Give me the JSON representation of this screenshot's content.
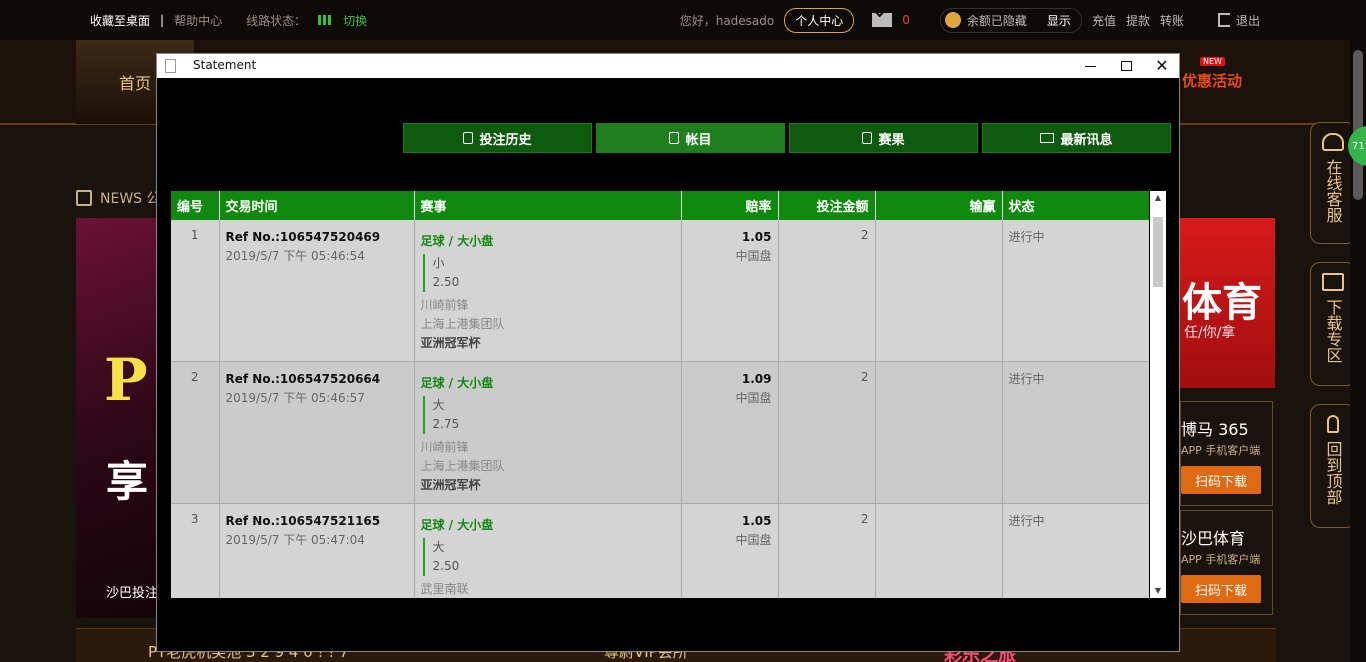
{
  "topbar": {
    "favorite": "收藏至桌面",
    "separator": "|",
    "help": "帮助中心",
    "line_status": "线路状态：",
    "switch": "切换",
    "greeting": "您好，hadesado",
    "personal_center": "个人中心",
    "mail_count": "0",
    "balance_hidden": "余额已隐藏",
    "show": "显示",
    "deposit": "充值",
    "withdraw": "提款",
    "transfer": "转账",
    "logout": "退出"
  },
  "nav": {
    "home": "首页",
    "promotions": "优惠活动",
    "new_badge": "NEW"
  },
  "background": {
    "news": "NEWS 公",
    "promo_big1": "P",
    "promo_big2": "享",
    "promo_caption": "沙巴投注",
    "bottom_text1": "PT老虎机奖池 3 2 9 4 0 ! ! 7",
    "bottom_text2": "尊尉VIP会所",
    "bottom_text3": "彩乐之旅",
    "right_promo_big": "体育",
    "right_promo_sub": "任/你/拿",
    "app1_name": "博马 365",
    "app1_desc": "APP 手机客户端",
    "app2_name": "沙巴体育",
    "app2_desc": "APP 手机客户端",
    "download": "扫码下载",
    "side_service": "在线客服",
    "side_download": "下载专区",
    "side_top": "回到顶部",
    "badge_num": "71"
  },
  "window": {
    "title": "Statement",
    "minimize_label": "",
    "close_label": "✕"
  },
  "tabs": [
    {
      "label": "投注历史"
    },
    {
      "label": "帐目"
    },
    {
      "label": "赛果"
    },
    {
      "label": "最新讯息"
    }
  ],
  "table": {
    "headers": [
      "编号",
      "交易时间",
      "赛事",
      "赔率",
      "投注金额",
      "输赢",
      "状态"
    ],
    "rows": [
      {
        "num": "1",
        "ref": "Ref No.:106547520469",
        "time": "2019/5/7 下午 05:46:54",
        "market": "足球 / 大小盘",
        "pick": "小",
        "line": "2.50",
        "home": "川崎前锋",
        "away": "上海上港集团队",
        "league": "亚洲冠军杯",
        "odds": "1.05",
        "odds_type": "中国盘",
        "stake": "2",
        "winloss": "",
        "status": "进行中"
      },
      {
        "num": "2",
        "ref": "Ref No.:106547520664",
        "time": "2019/5/7 下午 05:46:57",
        "market": "足球 / 大小盘",
        "pick": "大",
        "line": "2.75",
        "home": "川崎前锋",
        "away": "上海上港集团队",
        "league": "亚洲冠军杯",
        "odds": "1.09",
        "odds_type": "中国盘",
        "stake": "2",
        "winloss": "",
        "status": "进行中"
      },
      {
        "num": "3",
        "ref": "Ref No.:106547521165",
        "time": "2019/5/7 下午 05:47:04",
        "market": "足球 / 大小盘",
        "pick": "大",
        "line": "2.50",
        "home": "武里南联",
        "away": "",
        "league": "",
        "odds": "1.05",
        "odds_type": "中国盘",
        "stake": "2",
        "winloss": "",
        "status": "进行中"
      }
    ]
  },
  "colors": {
    "accent_green": "#0f8a0f",
    "gold": "#e7c586",
    "red": "#e84c1c"
  }
}
